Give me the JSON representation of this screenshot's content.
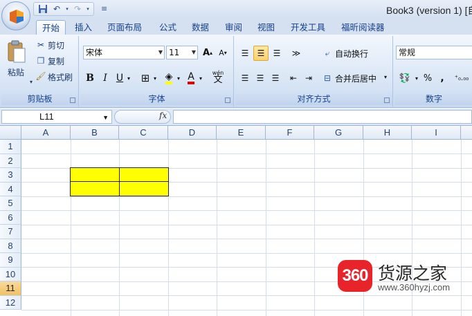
{
  "window": {
    "title": "Book3 (version 1) [自"
  },
  "quick_access": {
    "icons": [
      "save-icon",
      "undo-icon",
      "redo-icon",
      "customize-icon"
    ]
  },
  "tabs": [
    {
      "label": "开始",
      "active": true
    },
    {
      "label": "插入"
    },
    {
      "label": "页面布局"
    },
    {
      "label": "公式"
    },
    {
      "label": "数据"
    },
    {
      "label": "审阅"
    },
    {
      "label": "视图"
    },
    {
      "label": "开发工具"
    },
    {
      "label": "福昕阅读器"
    }
  ],
  "ribbon": {
    "clipboard": {
      "group": "剪贴板",
      "paste": "粘贴",
      "cut": "剪切",
      "copy": "复制",
      "format_painter": "格式刷"
    },
    "font": {
      "group": "字体",
      "font_name": "宋体",
      "font_size": "11",
      "bold": "B",
      "italic": "I",
      "underline": "U",
      "font_color_letter": "A",
      "phonetic": "wén"
    },
    "alignment": {
      "group": "对齐方式",
      "wrap_text": "自动换行",
      "merge_center": "合并后居中"
    },
    "number": {
      "group": "数字",
      "format": "常规",
      "percent": "%",
      "comma": ","
    }
  },
  "formula_bar": {
    "name_box": "L11",
    "fx": "fx",
    "formula": ""
  },
  "sheet": {
    "columns": [
      "A",
      "B",
      "C",
      "D",
      "E",
      "F",
      "G",
      "H",
      "I"
    ],
    "rows": [
      "1",
      "2",
      "3",
      "4",
      "5",
      "6",
      "7",
      "8",
      "9",
      "10",
      "11",
      "12"
    ],
    "active_row": "11",
    "highlighted_cells": [
      "B3",
      "C3",
      "B4",
      "C4"
    ],
    "highlight_color": "#ffff00"
  },
  "watermark": {
    "badge": "360",
    "name": "货源之家",
    "url": "www.360hyzj.com"
  }
}
